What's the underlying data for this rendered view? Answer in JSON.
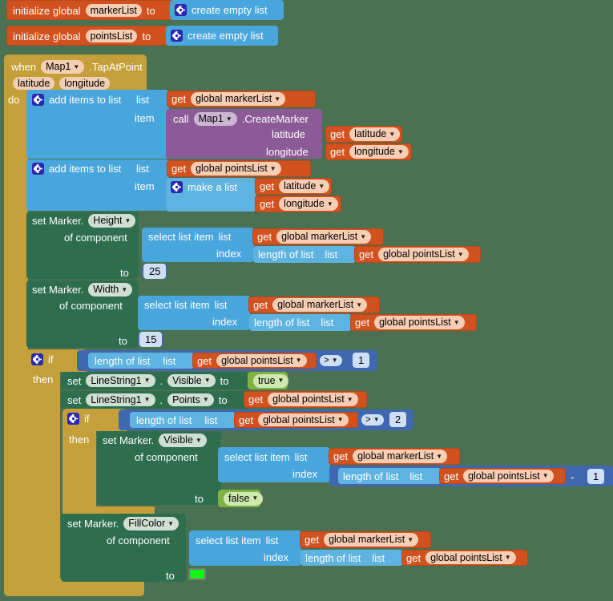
{
  "workspace": {
    "background_color": "#4a7151"
  },
  "blocks": {
    "init_marker": {
      "text_initialize": "initialize global",
      "name": "markerList",
      "text_to": "to",
      "value_label": "create empty list",
      "gear_icon": "gear-icon"
    },
    "init_points": {
      "text_initialize": "initialize global",
      "name": "pointsList",
      "text_to": "to",
      "value_label": "create empty list",
      "gear_icon": "gear-icon"
    },
    "event": {
      "when": "when",
      "component": "Map1",
      "event_name": ".TapAtPoint",
      "param1": "latitude",
      "param2": "longitude",
      "do_label": "do"
    },
    "add_marker": {
      "gear_icon": "gear-icon",
      "label": "add items to list",
      "list_label": "list",
      "item_label": "item",
      "list_get": "get",
      "list_var": "global markerList"
    },
    "create_marker_call": {
      "call": "call",
      "component": "Map1",
      "method": ".CreateMarker",
      "arg1_label": "latitude",
      "arg1_get": "get",
      "arg1_var": "latitude",
      "arg2_label": "longitude",
      "arg2_get": "get",
      "arg2_var": "longitude"
    },
    "add_points": {
      "gear_icon": "gear-icon",
      "label": "add items to list",
      "list_label": "list",
      "item_label": "item",
      "list_get": "get",
      "list_var": "global pointsList",
      "make_list_gear": "gear-icon",
      "make_list_label": "make a list",
      "item1_get": "get",
      "item1_var": "latitude",
      "item2_get": "get",
      "item2_var": "longitude"
    },
    "set_height": {
      "set_label": "set Marker.",
      "property": "Height",
      "of_component": "of component",
      "select_label": "select list item",
      "list_label": "list",
      "list_get": "get",
      "list_var": "global markerList",
      "index_label": "index",
      "length_label": "length of list",
      "length_list_label": "list",
      "length_get": "get",
      "length_var": "global pointsList",
      "to_label": "to",
      "value": "25"
    },
    "set_width": {
      "set_label": "set Marker.",
      "property": "Width",
      "of_component": "of component",
      "select_label": "select list item",
      "list_label": "list",
      "list_get": "get",
      "list_var": "global markerList",
      "index_label": "index",
      "length_label": "length of list",
      "length_list_label": "list",
      "length_get": "get",
      "length_var": "global pointsList",
      "to_label": "to",
      "value": "15"
    },
    "if_outer": {
      "gear_icon": "gear-icon",
      "if_label": "if",
      "then_label": "then",
      "length_label": "length of list",
      "length_list_label": "list",
      "length_get": "get",
      "length_var": "global pointsList",
      "operator": ">",
      "compare_value": "1"
    },
    "set_linestring_visible": {
      "set_label": "set",
      "component": "LineString1",
      "dot": ".",
      "property": "Visible",
      "to_label": "to",
      "value": "true"
    },
    "set_linestring_points": {
      "set_label": "set",
      "component": "LineString1",
      "dot": ".",
      "property": "Points",
      "to_label": "to",
      "get": "get",
      "value_var": "global pointsList"
    },
    "if_inner": {
      "gear_icon": "gear-icon",
      "if_label": "if",
      "then_label": "then",
      "length_label": "length of list",
      "length_list_label": "list",
      "length_get": "get",
      "length_var": "global pointsList",
      "operator": ">",
      "compare_value": "2"
    },
    "set_marker_visible": {
      "set_label": "set Marker.",
      "property": "Visible",
      "of_component": "of component",
      "select_label": "select list item",
      "list_label": "list",
      "list_get": "get",
      "list_var": "global markerList",
      "index_label": "index",
      "length_label": "length of list",
      "length_list_label": "list",
      "length_get": "get",
      "length_var": "global pointsList",
      "minus_operator": "-",
      "minus_value": "1",
      "to_label": "to",
      "value": "false"
    },
    "set_fill_color": {
      "set_label": "set Marker.",
      "property": "FillColor",
      "of_component": "of component",
      "select_label": "select list item",
      "list_label": "list",
      "list_get": "get",
      "list_var": "global markerList",
      "index_label": "index",
      "length_label": "length of list",
      "length_list_label": "list",
      "length_get": "get",
      "length_var": "global pointsList",
      "to_label": "to",
      "color_value": "#12f712",
      "color_name": "green"
    }
  }
}
